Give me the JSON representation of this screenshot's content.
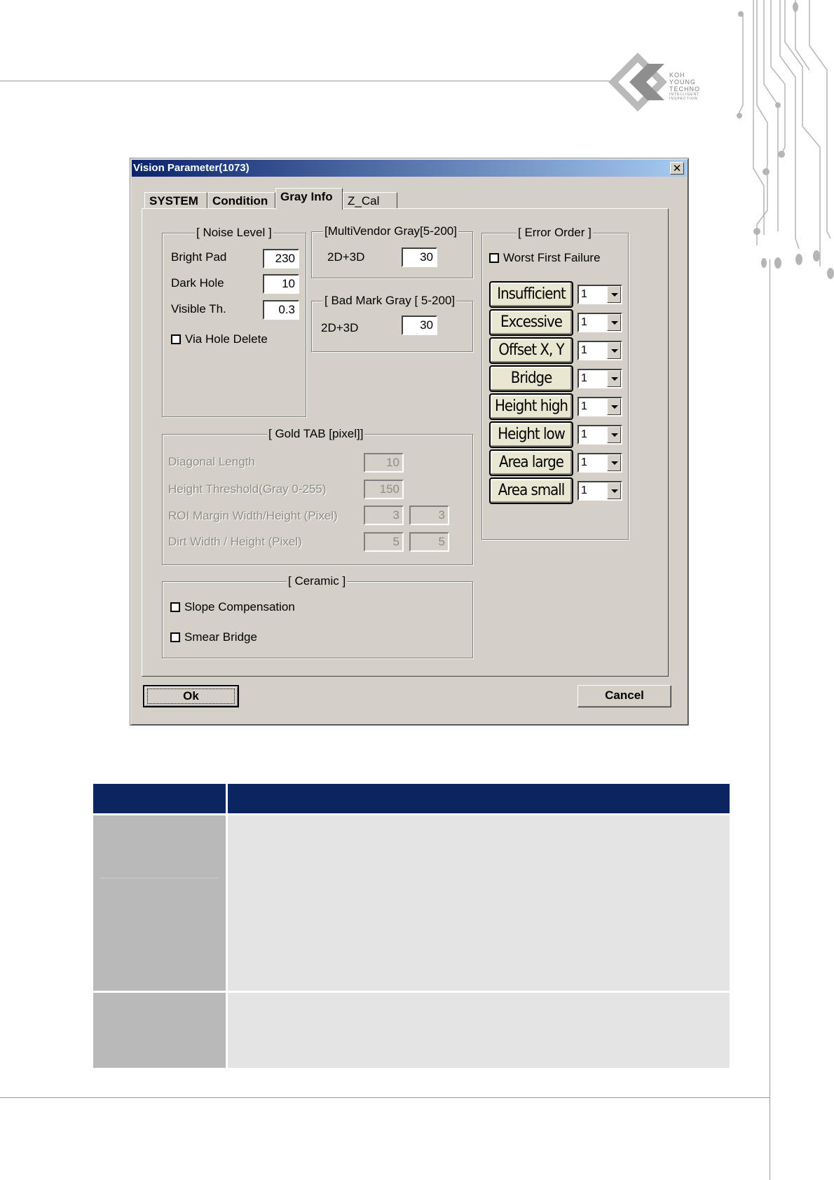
{
  "dialog": {
    "title": "Vision Parameter(1073)",
    "close_label": "✕",
    "tabs": [
      "SYSTEM",
      "Condition",
      "Gray Info",
      "Z_Cal"
    ],
    "active_tab": "Gray Info",
    "noise_level": {
      "title": "[ Noise Level ]",
      "bright_pad_label": "Bright Pad",
      "bright_pad_value": "230",
      "dark_hole_label": "Dark Hole",
      "dark_hole_value": "10",
      "visible_th_label": "Visible Th.",
      "visible_th_value": "0.3",
      "via_hole_delete_label": "Via Hole Delete"
    },
    "multivendor": {
      "title": "[MultiVendor Gray[5-200]",
      "label": "2D+3D",
      "value": "30"
    },
    "bad_mark": {
      "title": "[ Bad Mark Gray [ 5-200]",
      "label": "2D+3D",
      "value": "30"
    },
    "gold_tab": {
      "title": "[ Gold TAB [pixel]]",
      "diag_label": "Diagonal Length",
      "diag_value": "10",
      "height_label": "Height Threshold(Gray 0-255)",
      "height_value": "150",
      "roi_label": "ROI Margin Width/Height (Pixel)",
      "roi_w": "3",
      "roi_h": "3",
      "dirt_label": "Dirt Width / Height (Pixel)",
      "dirt_w": "5",
      "dirt_h": "5"
    },
    "ceramic": {
      "title": "[ Ceramic ]",
      "slope_label": "Slope Compensation",
      "smear_label": "Smear Bridge"
    },
    "error_order": {
      "title": "[ Error Order ]",
      "worst_first_label": "Worst First Failure",
      "items": [
        {
          "label": "Insufficient",
          "value": "1"
        },
        {
          "label": "Excessive",
          "value": "1"
        },
        {
          "label": "Offset X, Y",
          "value": "1"
        },
        {
          "label": "Bridge",
          "value": "1"
        },
        {
          "label": "Height high",
          "value": "1"
        },
        {
          "label": "Height low",
          "value": "1"
        },
        {
          "label": "Area large",
          "value": "1"
        },
        {
          "label": "Area small",
          "value": "1"
        }
      ]
    },
    "ok_label": "Ok",
    "cancel_label": "Cancel"
  },
  "logo": {
    "line1": "KOH",
    "line2": "YOUNG",
    "line3": "TECHNO",
    "line4": "INTELLIGENT",
    "line5": "INSPECTION"
  },
  "colors": {
    "table_header": "#0b2560",
    "dialog_face": "#d4d0c8",
    "title_start": "#0a246a"
  }
}
